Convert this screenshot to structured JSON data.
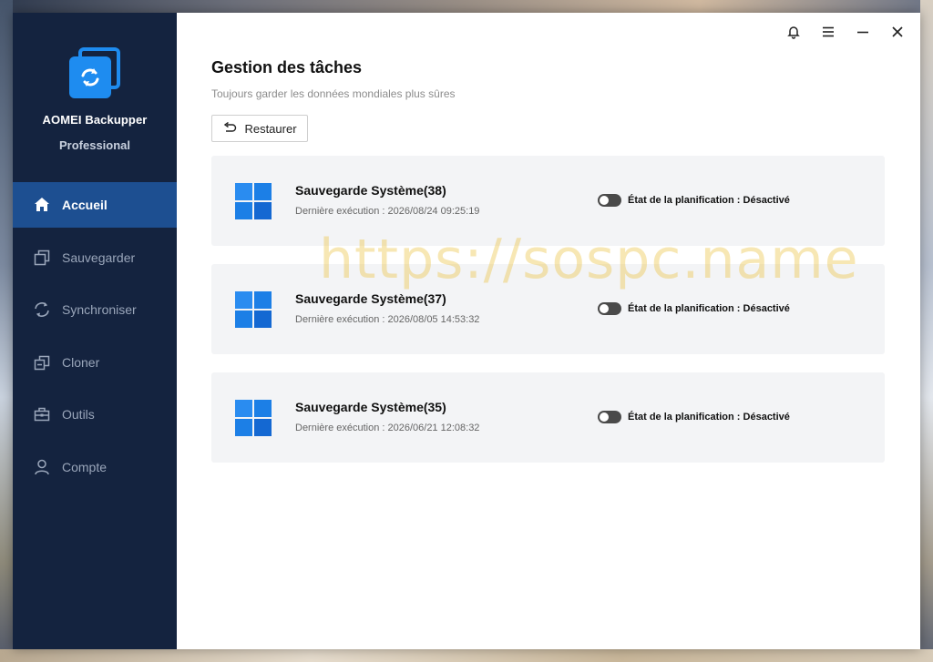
{
  "app": {
    "name": "AOMEI Backupper",
    "edition": "Professional"
  },
  "sidebar": {
    "items": [
      {
        "label": "Accueil",
        "icon": "home-icon",
        "active": true
      },
      {
        "label": "Sauvegarder",
        "icon": "backup-icon",
        "active": false
      },
      {
        "label": "Synchroniser",
        "icon": "sync-icon",
        "active": false
      },
      {
        "label": "Cloner",
        "icon": "clone-icon",
        "active": false
      },
      {
        "label": "Outils",
        "icon": "toolbox-icon",
        "active": false
      },
      {
        "label": "Compte",
        "icon": "user-icon",
        "active": false
      }
    ]
  },
  "titlebar": {
    "icons": [
      "bell-icon",
      "menu-icon",
      "minimize-icon",
      "close-icon"
    ]
  },
  "main": {
    "title": "Gestion des tâches",
    "subtitle": "Toujours garder les données mondiales plus sûres",
    "restore_label": "Restaurer"
  },
  "tasks": [
    {
      "name": "Sauvegarde Système(38)",
      "last_run": "Dernière exécution : 2026/08/24 09:25:19",
      "schedule_status": "État de la planification : Désactivé",
      "enabled": false
    },
    {
      "name": "Sauvegarde Système(37)",
      "last_run": "Dernière exécution : 2026/08/05 14:53:32",
      "schedule_status": "État de la planification : Désactivé",
      "enabled": false
    },
    {
      "name": "Sauvegarde Système(35)",
      "last_run": "Dernière exécution : 2026/06/21 12:08:32",
      "schedule_status": "État de la planification : Désactivé",
      "enabled": false
    }
  ],
  "watermark": "https://sospc.name",
  "colors": {
    "sidebar_bg": "#14233f",
    "active_item_bg": "#1d4f91",
    "accent": "#1e8cf0",
    "card_bg": "#f3f4f6"
  }
}
